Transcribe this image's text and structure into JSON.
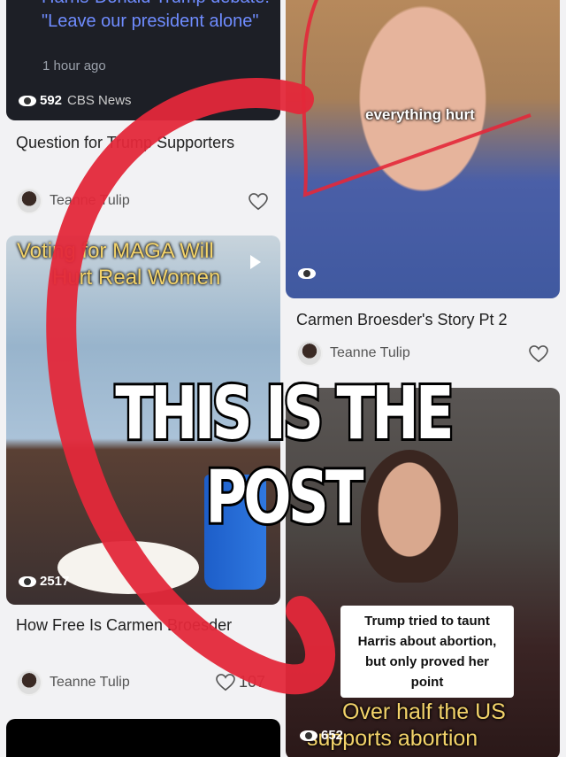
{
  "feed": {
    "card1": {
      "title": "Harris-Donald Trump debate: \"Leave our president alone\"",
      "time": "1 hour ago",
      "views": "592",
      "source": "CBS News"
    },
    "card2": {
      "overlay": "everything hurt",
      "title": "Carmen Broesder's Story Pt 2",
      "author": "Teanne Tulip"
    },
    "card3": {
      "title": "Question for Trump Supporters",
      "author": "Teanne Tulip"
    },
    "card4": {
      "overlay_line1": "Voting for MAGA Will",
      "overlay_line2": "Hurt Real Women",
      "views": "2517",
      "title": "How Free Is Carmen Broesder",
      "author": "Teanne Tulip",
      "likes": "107"
    },
    "card5": {
      "caption_box": "Trump tried to taunt Harris about abortion, but only proved her point",
      "bottom_line1": "Over half the US",
      "bottom_line2": "supports abortion",
      "views": "652"
    },
    "overlay_banner": "THIS IS THE POST",
    "colors": {
      "accent_red": "#e3283a",
      "link_blue": "#6f8cff"
    }
  }
}
